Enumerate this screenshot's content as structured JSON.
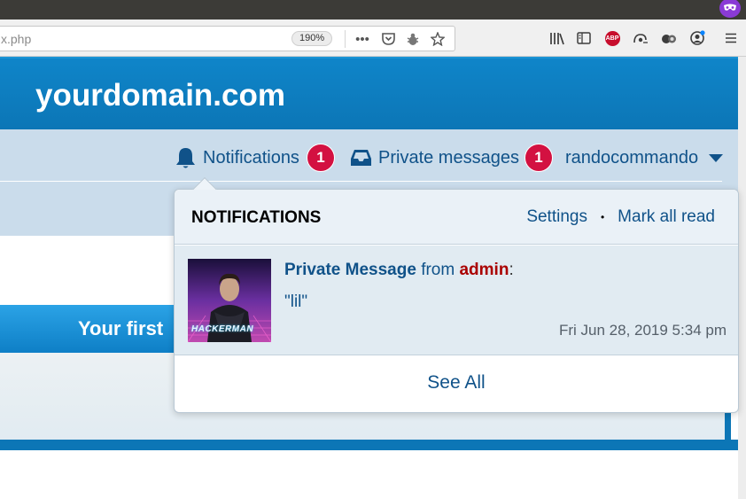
{
  "browser": {
    "url_text": "x.php",
    "zoom_label": "190%",
    "toolbar_icons": [
      "page-actions-icon",
      "pocket-icon",
      "bug-icon",
      "bookmark-star-icon",
      "library-icon",
      "sidebar-icon",
      "adblock-plus-icon",
      "extension-icon",
      "extension-icon-2",
      "account-icon",
      "menu-icon"
    ],
    "extension_icon": "private-mask-icon",
    "abp_label": "ABP"
  },
  "site": {
    "title": "yourdomain.com"
  },
  "nav": {
    "notifications_label": "Notifications",
    "notifications_count": "1",
    "pm_label": "Private messages",
    "pm_count": "1",
    "username": "randocommando"
  },
  "forum": {
    "title_visible": "Your first"
  },
  "dropdown": {
    "heading": "NOTIFICATIONS",
    "settings_label": "Settings",
    "separator": "•",
    "mark_all_label": "Mark all read",
    "notification": {
      "type_label": "Private Message",
      "from_word": "from",
      "author": "admin",
      "colon": ":",
      "quote": "\"lil\"",
      "time": "Fri Jun 28, 2019 5:34 pm",
      "avatar_text": "HACKERMAN"
    },
    "see_all_label": "See All"
  },
  "colors": {
    "header_blue": "#0c76b6",
    "nav_link": "#105289",
    "badge_red": "#d31141",
    "author_red": "#aa0000"
  }
}
